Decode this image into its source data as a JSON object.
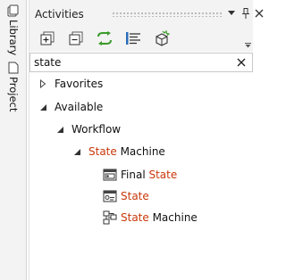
{
  "side_tabs": [
    {
      "label": "Library",
      "icon": "books-icon"
    },
    {
      "label": "Project",
      "icon": "project-file-icon"
    }
  ],
  "panel": {
    "title": "Activities",
    "title_buttons": [
      "dropdown-arrow-icon",
      "pin-icon",
      "close-icon"
    ]
  },
  "toolbar": {
    "buttons": [
      {
        "name": "expand-all-button",
        "icon": "expand-all-icon"
      },
      {
        "name": "collapse-all-button",
        "icon": "collapse-all-icon"
      },
      {
        "name": "refresh-button",
        "icon": "refresh-icon"
      },
      {
        "name": "filter-button",
        "icon": "list-filter-icon"
      },
      {
        "name": "manage-packages-button",
        "icon": "package-icon"
      }
    ],
    "overflow_icon": "chevron-down-icon"
  },
  "search": {
    "value": "state",
    "placeholder": ""
  },
  "tree": {
    "highlight_color": "#c8380a",
    "nodes": [
      {
        "label": "Favorites",
        "expander": "collapsed"
      },
      {
        "label": "Available",
        "expander": "expanded"
      },
      {
        "label": "Workflow",
        "expander": "expanded"
      },
      {
        "label_highlight": "State",
        "label_rest": " Machine",
        "expander": "expanded"
      },
      {
        "label_plain": "Final ",
        "label_highlight": "State",
        "icon": "final-state-icon"
      },
      {
        "label_highlight": "State",
        "icon": "state-icon"
      },
      {
        "label_highlight": "State",
        "label_rest": " Machine",
        "icon": "state-machine-icon"
      }
    ]
  }
}
